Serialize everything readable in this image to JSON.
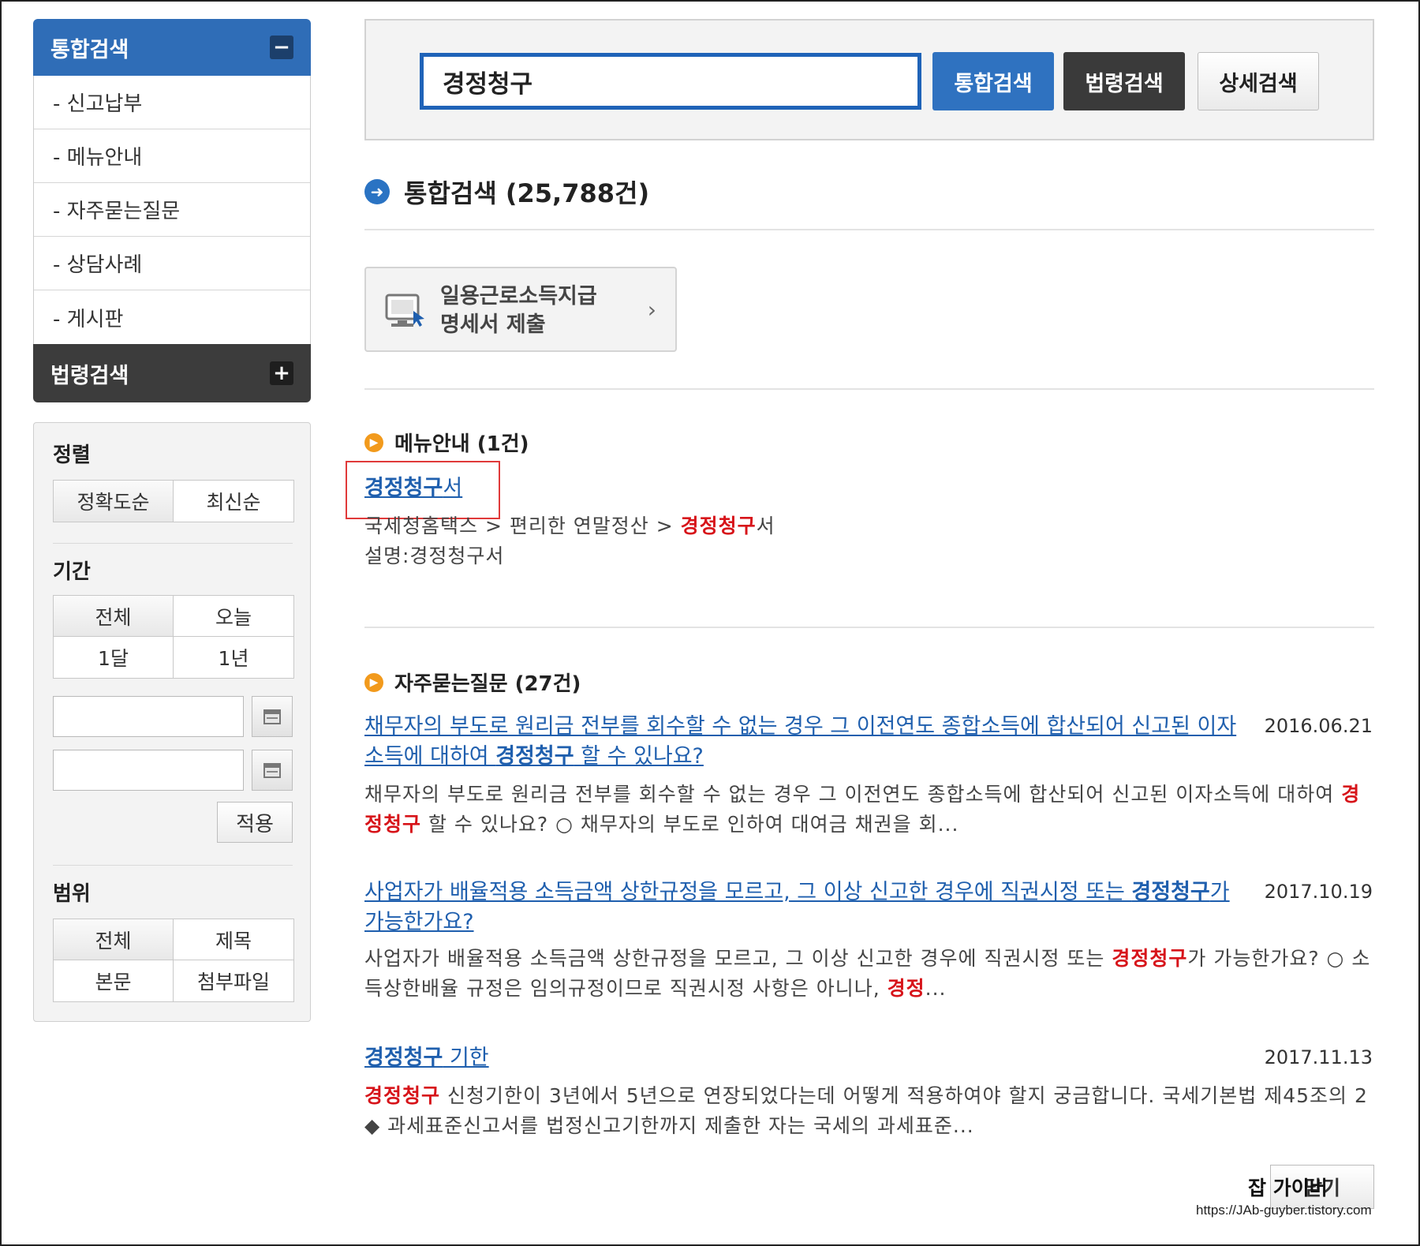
{
  "sidebar": {
    "header_search": "통합검색",
    "toggle_minus": "−",
    "items": [
      {
        "label": "- 신고납부"
      },
      {
        "label": "- 메뉴안내"
      },
      {
        "label": "- 자주묻는질문"
      },
      {
        "label": "- 상담사례"
      },
      {
        "label": "- 게시판"
      }
    ],
    "header_law": "법령검색",
    "toggle_plus": "+"
  },
  "filter": {
    "sort_title": "정렬",
    "sort_options": [
      "정확도순",
      "최신순"
    ],
    "period_title": "기간",
    "period_options": [
      "전체",
      "오늘",
      "1달",
      "1년"
    ],
    "apply_label": "적용",
    "scope_title": "범위",
    "scope_options": [
      "전체",
      "제목",
      "본문",
      "첨부파일"
    ]
  },
  "search": {
    "query": "경정청구",
    "btn_integrated": "통합검색",
    "btn_law": "법령검색",
    "btn_detail": "상세검색"
  },
  "results": {
    "title": "통합검색 (25,788건)",
    "quick_card": {
      "line1": "일용근로소득지급",
      "line2": "명세서 제출",
      "chevron": "›"
    },
    "menu_section": {
      "title": "메뉴안내 (1건)",
      "link_bold": "경정청구",
      "link_rest": "서",
      "path_prefix": "국세청홈택스 > 편리한 연말정산 > ",
      "path_hl": "경정청구",
      "path_suffix": "서",
      "desc": "설명:경정청구서"
    },
    "faq_section": {
      "title": "자주묻는질문 (27건)",
      "items": [
        {
          "date": "2016.06.21",
          "link_pre": "채무자의 부도로 원리금 전부를 회수할 수 없는 경우 그 이전연도 종합소득에 합산되어 신고된 이자소득에 대하여 ",
          "link_bold": "경정청구",
          "link_post": " 할 수 있나요?",
          "desc_pre": "채무자의 부도로 원리금 전부를 회수할 수 없는 경우 그 이전연도 종합소득에 합산되어 신고된 이자소득에 대하여 ",
          "desc_hl": "경정청구",
          "desc_post": " 할 수 있나요? ○ 채무자의 부도로 인하여 대여금 채권을 회..."
        },
        {
          "date": "2017.10.19",
          "link_pre": "사업자가 배율적용 소득금액 상한규정을 모르고, 그 이상 신고한 경우에 직권시정 또는 ",
          "link_bold": "경정청구",
          "link_post": "가 가능한가요?",
          "desc_pre": "사업자가 배율적용 소득금액 상한규정을 모르고, 그 이상 신고한 경우에 직권시정 또는 ",
          "desc_hl": "경정청구",
          "desc_mid": "가 가능한가요? ○ 소득상한배율 규정은 임의규정이므로 직권시정 사항은 아니나, ",
          "desc_hl2": "경정",
          "desc_post": "..."
        },
        {
          "date": "2017.11.13",
          "link_bold": "경정청구",
          "link_post": " 기한",
          "desc_hl": "경정청구",
          "desc_post": " 신청기한이 3년에서 5년으로 연장되었다는데 어떻게 적용하여야 할지 궁금합니다. 국세기본법 제45조의 2 ◆ 과세표준신고서를 법정신고기한까지 제출한 자는 국세의 과세표준..."
        }
      ]
    }
  },
  "close_label": "닫기",
  "watermark": {
    "text": "잡 가이버",
    "url": "https://JAb-guyber.tistory.com"
  }
}
